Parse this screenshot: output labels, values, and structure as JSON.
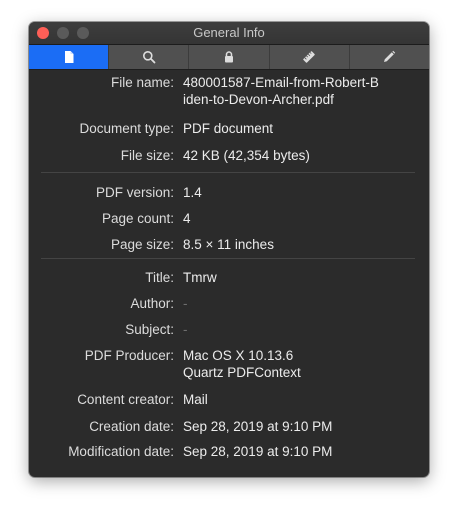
{
  "window": {
    "title": "General Info",
    "traffic_colors": {
      "close": "#fe5f57",
      "minimize": "#5a5a5a",
      "zoom": "#5a5a5a"
    }
  },
  "toolbar": {
    "active_color": "#1b6df5",
    "tabs": [
      {
        "icon": "document-icon",
        "active": true
      },
      {
        "icon": "search-icon",
        "active": false
      },
      {
        "icon": "lock-icon",
        "active": false
      },
      {
        "icon": "ruler-icon",
        "active": false
      },
      {
        "icon": "pencil-icon",
        "active": false
      }
    ]
  },
  "file_info": {
    "file_name_label": "File name:",
    "file_name_line1": "480001587-Email-from-Robert-B",
    "file_name_line2": "iden-to-Devon-Archer.pdf",
    "document_type_label": "Document type:",
    "document_type": "PDF document",
    "file_size_label": "File size:",
    "file_size": "42 KB (42,354 bytes)"
  },
  "pdf_info": {
    "pdf_version_label": "PDF version:",
    "pdf_version": "1.4",
    "page_count_label": "Page count:",
    "page_count": "4",
    "page_size_label": "Page size:",
    "page_size": "8.5 × 11 inches"
  },
  "metadata": {
    "title_label": "Title:",
    "title": "Tmrw",
    "author_label": "Author:",
    "author": "-",
    "subject_label": "Subject:",
    "subject": "-",
    "producer_label": "PDF Producer:",
    "producer_line1": "Mac OS X 10.13.6",
    "producer_line2": "Quartz PDFContext",
    "creator_label": "Content creator:",
    "creator": "Mail",
    "creation_date_label": "Creation date:",
    "creation_date": "Sep 28, 2019 at 9:10 PM",
    "modification_date_label": "Modification date:",
    "modification_date": "Sep 28, 2019 at 9:10 PM"
  }
}
